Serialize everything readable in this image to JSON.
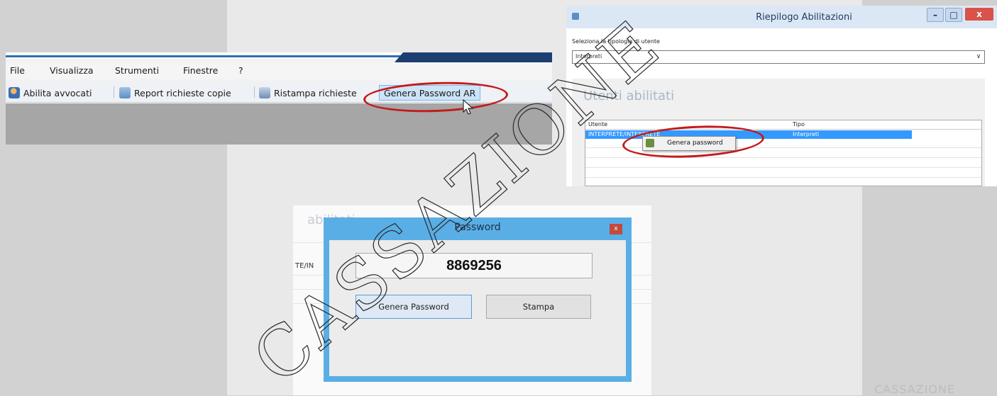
{
  "main_app": {
    "menu": [
      "File",
      "Visualizza",
      "Strumenti",
      "Finestre",
      "?"
    ],
    "toolbar": {
      "abilita_avvocati": "Abilita avvocati",
      "report_richieste": "Report richieste copie",
      "ristampa_richieste": "Ristampa richieste",
      "genera_password_ar": "Genera Password AR"
    }
  },
  "riepilogo": {
    "title": "Riepilogo Abilitazioni",
    "select_label": "Seleziona la tipologia di utente",
    "select_value": "Interpreti",
    "panel_title": "Utenti abilitati",
    "columns": [
      "Utente",
      "Tipo"
    ],
    "selected_row": {
      "utente": "INTERPRETE/INTERPRETE",
      "tipo": "Interpreti"
    },
    "context_menu_item": "Genera password"
  },
  "password_dialog": {
    "title": "Password",
    "value": "8869256",
    "generate_button": "Genera Password",
    "print_button": "Stampa",
    "background_title": "abilitati",
    "background_cell": "TE/IN"
  },
  "watermark": {
    "text": "CASSAZIONE",
    "partial": "CASSAZIONE"
  },
  "colors": {
    "highlight_ring": "#c41a1a",
    "dialog_frame": "#5aaee6",
    "selection": "#3399ff"
  }
}
